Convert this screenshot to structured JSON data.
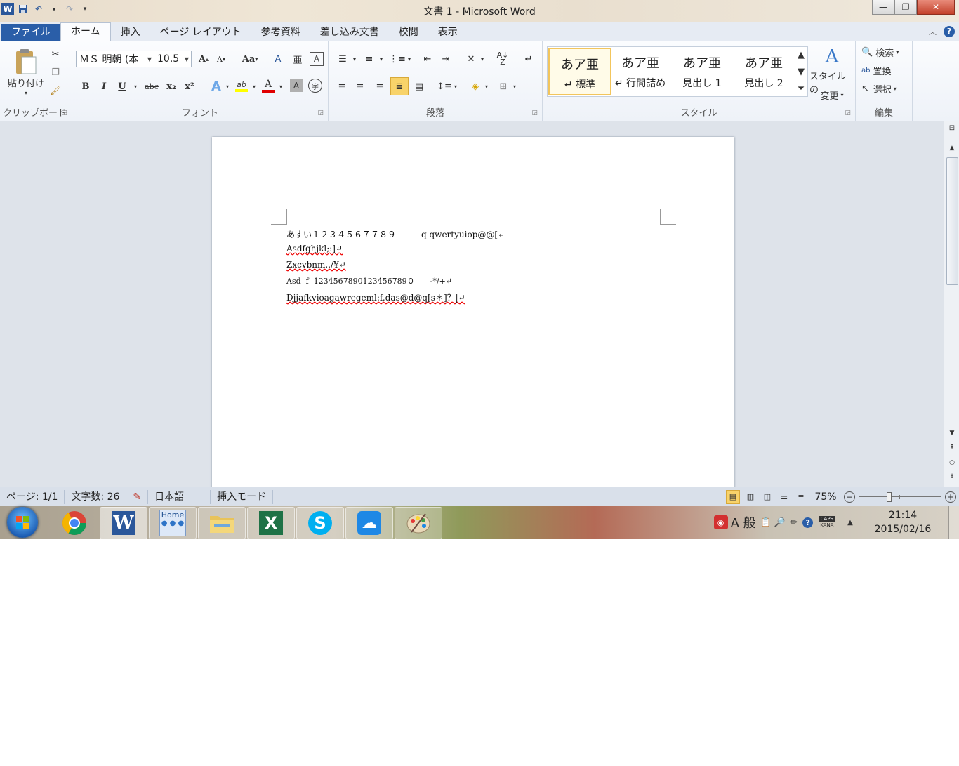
{
  "window": {
    "title": "文書 1 - Microsoft Word",
    "controls": {
      "minimize": "—",
      "restore": "❐",
      "close": "✕"
    }
  },
  "tabs": [
    {
      "label": "ファイル"
    },
    {
      "label": "ホーム"
    },
    {
      "label": "挿入"
    },
    {
      "label": "ページ レイアウト"
    },
    {
      "label": "参考資料"
    },
    {
      "label": "差し込み文書"
    },
    {
      "label": "校閲"
    },
    {
      "label": "表示"
    }
  ],
  "ribbon": {
    "clipboard": {
      "label": "クリップボード",
      "paste": "貼り付け"
    },
    "font": {
      "label": "フォント",
      "font_name": "ＭＳ 明朝 (本",
      "font_size": "10.5",
      "bold": "B",
      "italic": "I",
      "underline": "U",
      "strike": "abc",
      "subscript": "x₂",
      "superscript": "x²",
      "grow": "A",
      "shrink": "A",
      "case": "Aa",
      "highlight": "ab",
      "fontcolor": "A",
      "shade": "A",
      "circled": "字",
      "clear": "A",
      "phonetic": "亜"
    },
    "paragraph": {
      "label": "段落"
    },
    "styles": {
      "label": "スタイル",
      "items": [
        {
          "sample": "あア亜",
          "name": "↵ 標準"
        },
        {
          "sample": "あア亜",
          "name": "↵ 行間詰め"
        },
        {
          "sample": "あア亜",
          "name": "見出し 1"
        },
        {
          "sample": "あア亜",
          "name": "見出し 2"
        }
      ],
      "change_styles_line1": "スタイルの",
      "change_styles_line2": "変更"
    },
    "editing": {
      "label": "編集",
      "find": "検索",
      "replace": "置換",
      "select": "選択"
    }
  },
  "document": {
    "lines": [
      {
        "text": "あすい１２３４５６７７８９　　　q qwertyuiop@@[↵"
      },
      {
        "text": "Asdfghjkl;:]↵"
      },
      {
        "text": "Zxcvbnm,./¥↵"
      },
      {
        "text": "Asd  f  1234567890123456789０　　-*/+↵"
      },
      {
        "text": "Djjafkvioagawregeml:f.das@d@q[s＊]？|↵"
      }
    ]
  },
  "status": {
    "page": "ページ: 1/1",
    "words": "文字数: 26",
    "language": "日本語",
    "mode": "挿入モード",
    "zoom": "75%",
    "zoom_level_percent": 75
  },
  "taskbar": {
    "apps": [
      {
        "name": "chrome-icon"
      },
      {
        "name": "word-icon"
      },
      {
        "name": "home-icon",
        "label": "Home"
      },
      {
        "name": "folder-icon"
      },
      {
        "name": "excel-icon"
      },
      {
        "name": "skype-icon"
      },
      {
        "name": "cloud-icon"
      },
      {
        "name": "paint-icon"
      }
    ],
    "ime_mode": "A 般",
    "caps": "CAPS",
    "kana": "KANA",
    "time": "21:14",
    "date": "2015/02/16"
  },
  "colors": {
    "file_tab": "#2a5ea8",
    "accent": "#2b579a",
    "style_selected": "#f2c55c",
    "font_color_bar": "#e00000",
    "highlight_bar": "#ffff00"
  }
}
